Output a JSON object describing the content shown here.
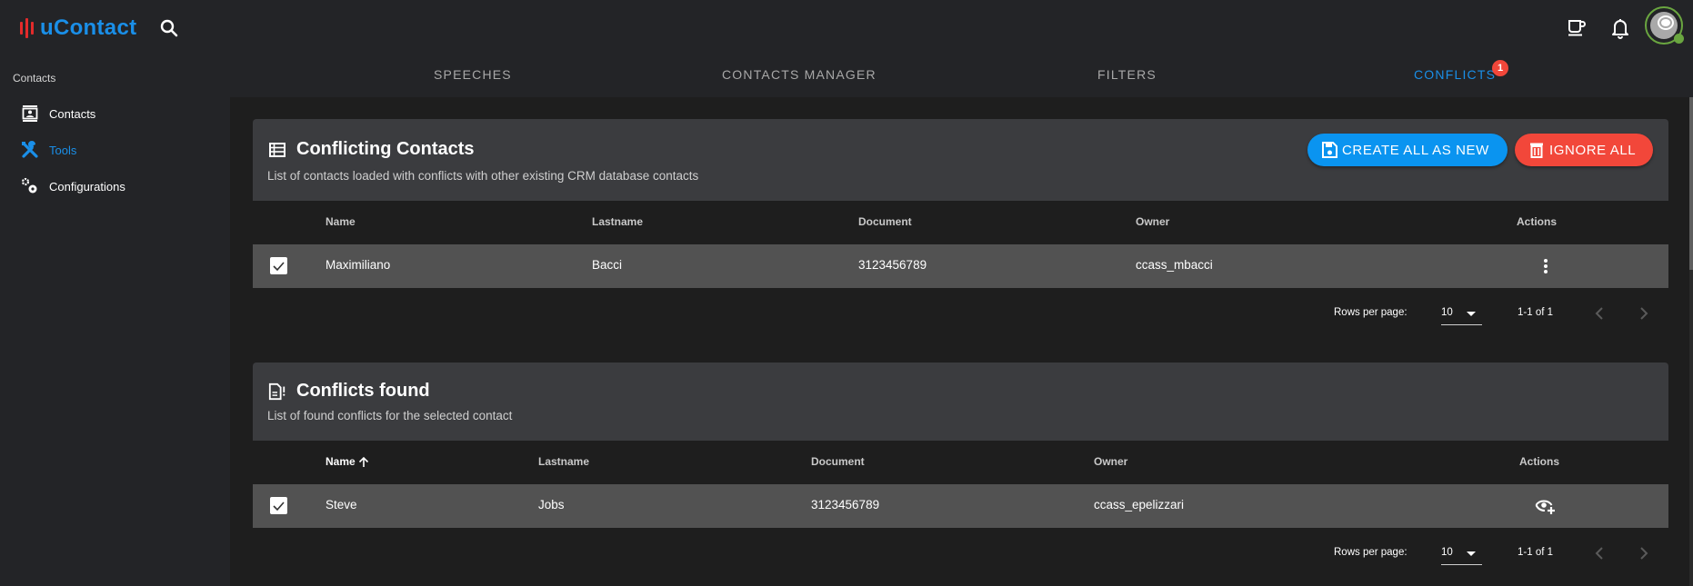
{
  "app": {
    "name": "uContact",
    "brand_color": "#1a8fe8",
    "logo_color": "#e32b2b"
  },
  "topbar": {
    "search_icon": "search-icon",
    "coffee_icon": "coffee-icon",
    "notifications_icon": "bell-icon",
    "avatar_status_color": "#6aa640"
  },
  "sidebar": {
    "section_label": "Contacts",
    "items": [
      {
        "label": "Contacts",
        "icon": "contact-card-icon",
        "active": false
      },
      {
        "label": "Tools",
        "icon": "tools-icon",
        "active": true
      },
      {
        "label": "Configurations",
        "icon": "gears-icon",
        "active": false
      }
    ]
  },
  "tabs": [
    {
      "label": "SPEECHES",
      "active": false
    },
    {
      "label": "CONTACTS MANAGER",
      "active": false
    },
    {
      "label": "FILTERS",
      "active": false
    },
    {
      "label": "CONFLICTS",
      "active": true,
      "badge": "1"
    }
  ],
  "conflicting_contacts": {
    "title": "Conflicting Contacts",
    "subtitle": "List of contacts loaded with conflicts with other existing CRM database contacts",
    "buttons": {
      "create_all": "CREATE ALL AS NEW",
      "ignore_all": "IGNORE ALL"
    },
    "columns": [
      "Name",
      "Lastname",
      "Document",
      "Owner",
      "Actions"
    ],
    "rows": [
      {
        "checked": true,
        "name": "Maximiliano",
        "lastname": "Bacci",
        "document": "3123456789",
        "owner": "ccass_mbacci",
        "action_icon": "more-vert-icon"
      }
    ],
    "pagination": {
      "rows_per_page_label": "Rows per page:",
      "rows_per_page": "10",
      "range": "1-1 of 1"
    }
  },
  "conflicts_found": {
    "title": "Conflicts found",
    "subtitle": "List of found conflicts for the selected contact",
    "columns": [
      "Name",
      "Lastname",
      "Document",
      "Owner",
      "Actions"
    ],
    "sort": {
      "column": "Name",
      "direction": "ascending"
    },
    "rows": [
      {
        "checked": true,
        "name": "Steve",
        "lastname": "Jobs",
        "document": "3123456789",
        "owner": "ccass_epelizzari",
        "action_icon": "eye-plus-icon"
      }
    ],
    "pagination": {
      "rows_per_page_label": "Rows per page:",
      "rows_per_page": "10",
      "range": "1-1 of 1"
    }
  }
}
